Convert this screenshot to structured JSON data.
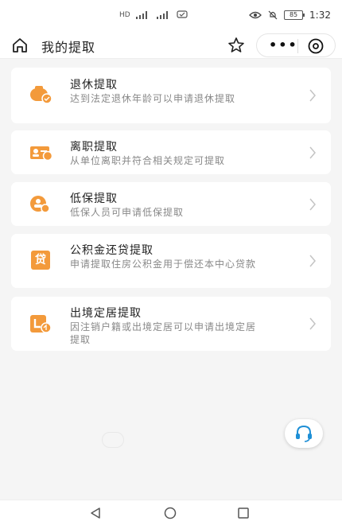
{
  "status_bar": {
    "time": "1:32",
    "battery": "85",
    "network_label": "HD",
    "colors": {
      "icon": "#555555"
    }
  },
  "header": {
    "title": "我的提取",
    "icons": [
      "home-icon",
      "star-icon",
      "more-icon",
      "close-icon"
    ]
  },
  "items": [
    {
      "title": "退休提取",
      "desc": "达到法定退休年龄可以申请退休提取",
      "icon": "retirement-icon"
    },
    {
      "title": "离职提取",
      "desc": "从单位离职并符合相关规定可提取",
      "icon": "resignation-icon"
    },
    {
      "title": "低保提取",
      "desc": "低保人员可申请低保提取",
      "icon": "low-income-icon"
    },
    {
      "title": "公积金还贷提取",
      "desc": "申请提取住房公积金用于偿还本中心贷款",
      "icon": "loan-icon",
      "icon_text": "贷"
    },
    {
      "title": "出境定居提取",
      "desc": "因注销户籍或出境定居可以申请出境定居提取",
      "icon": "emigration-icon"
    }
  ],
  "theme": {
    "accent": "#f39a3b",
    "text": "#222222",
    "subtext": "#888888",
    "background": "#f5f5f5"
  }
}
